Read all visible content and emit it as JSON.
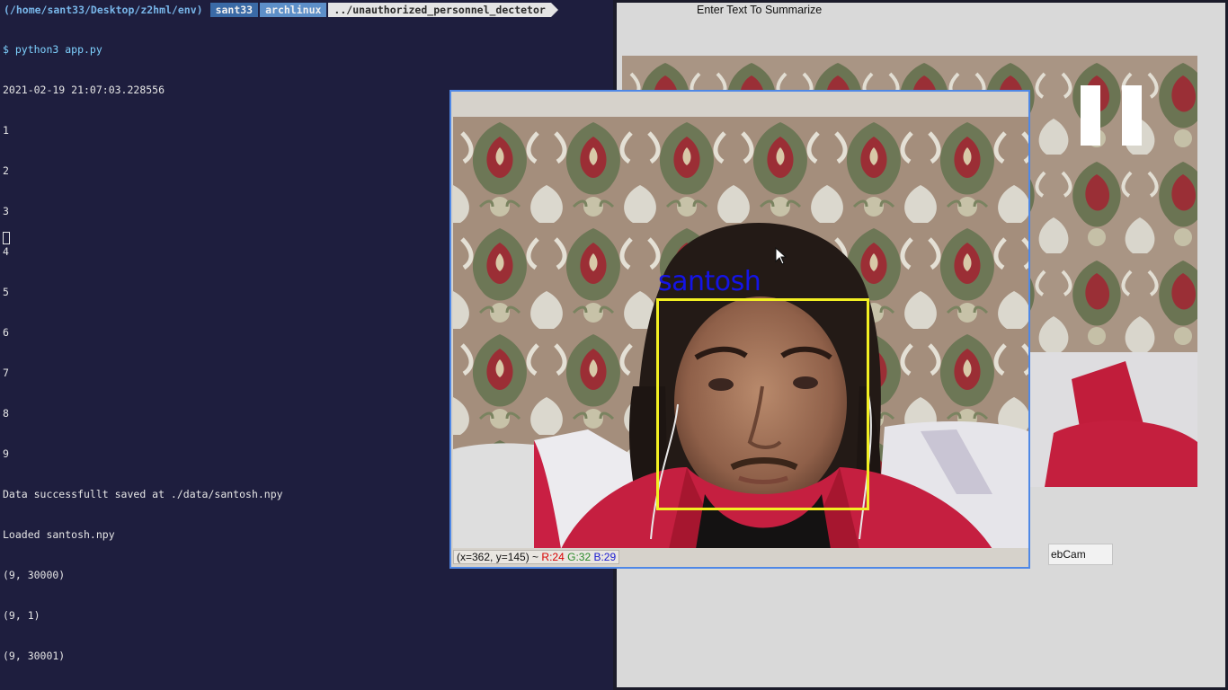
{
  "terminal": {
    "prompt": {
      "path": "(/home/sant33/Desktop/z2hml/env)",
      "user": "sant33",
      "host": "archlinux",
      "dir": "../unauthorized_personnel_dectetor"
    },
    "lines": [
      "$ python3 app.py",
      "2021-02-19 21:07:03.228556",
      "1",
      "2",
      "3",
      "4",
      "5",
      "6",
      "7",
      "8",
      "9",
      "Data successfullt saved at ./data/santosh.npy",
      "Loaded santosh.npy",
      "(9, 30000)",
      "(9, 1)",
      "(9, 30001)"
    ]
  },
  "app": {
    "title": "Enter Text To Summarize",
    "webcam_button": "ebCam"
  },
  "webcam_window": {
    "face_label": "santosh",
    "status": {
      "coords": "(x=362, y=145) ~",
      "r": "R:24",
      "g": "G:32",
      "b": "B:29"
    }
  },
  "colors": {
    "terminal_bg": "#1e1e3e",
    "face_box": "#f2ef22",
    "face_label": "#1414e6",
    "window_border": "#4f88e6"
  }
}
